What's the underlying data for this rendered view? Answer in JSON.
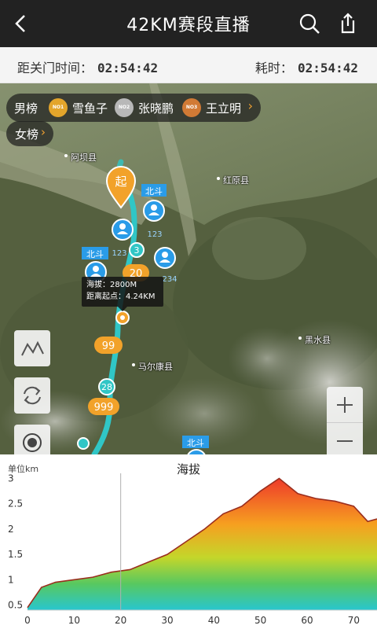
{
  "header": {
    "title": "42KM赛段直播",
    "icons": [
      "back-icon",
      "search-icon",
      "share-icon"
    ]
  },
  "timer": {
    "cutoff_label": "距关门时间：",
    "cutoff_value": "02:54:42",
    "elapsed_label": "耗时：",
    "elapsed_value": "02:54:42"
  },
  "map": {
    "men_label": "男榜",
    "women_label": "女榜",
    "ranking": [
      {
        "medal": "NO1",
        "name": "雪鱼子",
        "color": "#e3a52b"
      },
      {
        "medal": "NO2",
        "name": "张晓鹏",
        "color": "#b8b8b8"
      },
      {
        "medal": "NO3",
        "name": "王立明",
        "color": "#d17a35"
      }
    ],
    "places": [
      "阿坝县",
      "红原县",
      "马尔康县",
      "黑水县"
    ],
    "start_label": "起",
    "beidou_tags": [
      "北斗",
      "北斗",
      "北斗"
    ],
    "runner_numbers": [
      "123",
      "123",
      "234"
    ],
    "checkpoints": [
      "3",
      "20",
      "99",
      "28",
      "999"
    ],
    "tooltip": {
      "altitude": "海拔：2800M",
      "distance": "距离起点：4.24KM"
    },
    "controls": [
      "terrain-icon",
      "refresh-icon",
      "locate-icon",
      "zoom-in-icon",
      "zoom-out-icon"
    ]
  },
  "elevation": {
    "title": "海拔",
    "unit": "单位km"
  },
  "chart_data": {
    "type": "area",
    "title": "海拔",
    "xlabel": "",
    "ylabel": "单位km",
    "xlim": [
      0,
      75
    ],
    "ylim": [
      0.4,
      3.1
    ],
    "xticks": [
      "0",
      "10",
      "20",
      "30",
      "40",
      "50",
      "60",
      "70"
    ],
    "yticks": [
      "0.5",
      "1",
      "1.5",
      "2",
      "2.5",
      "3"
    ],
    "x": [
      0,
      3,
      6,
      10,
      14,
      18,
      22,
      26,
      30,
      34,
      38,
      42,
      46,
      50,
      54,
      58,
      62,
      66,
      70,
      73,
      75
    ],
    "y": [
      0.45,
      0.85,
      0.95,
      1.0,
      1.05,
      1.15,
      1.2,
      1.35,
      1.5,
      1.75,
      2.0,
      2.3,
      2.45,
      2.75,
      3.0,
      2.7,
      2.6,
      2.55,
      2.45,
      2.15,
      2.2
    ],
    "cursor_x": 20,
    "grid": false
  }
}
